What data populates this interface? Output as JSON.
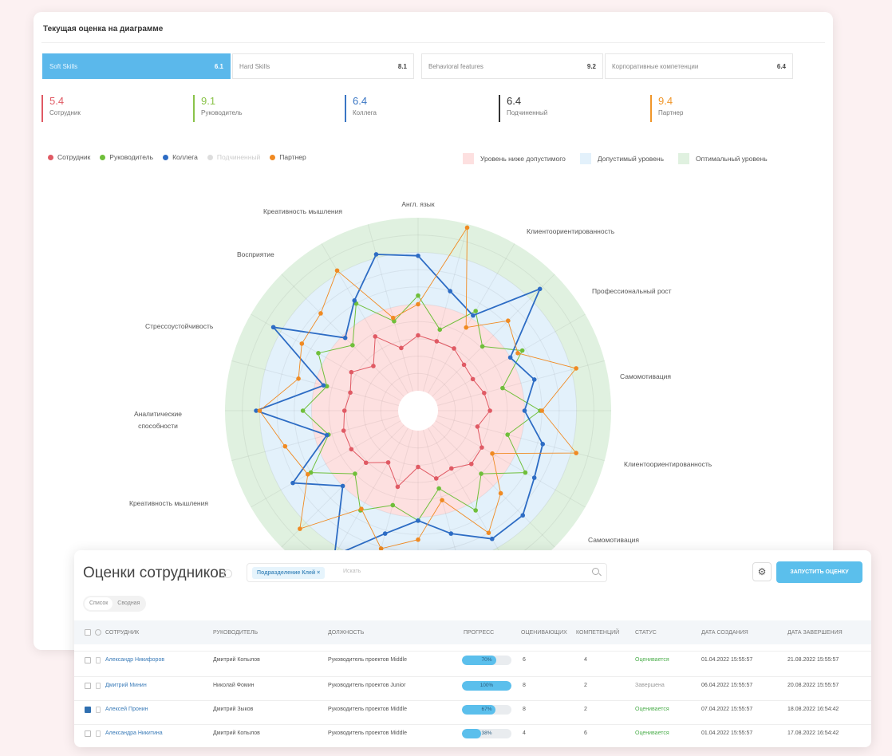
{
  "top": {
    "title": "Текущая оценка на диаграмме",
    "tabs": [
      {
        "label": "Soft Skills",
        "value": "6.1"
      },
      {
        "label": "Hard Skills",
        "value": "8.1"
      },
      {
        "label": "Behavioral features",
        "value": "9.2"
      },
      {
        "label": "Корпоративные компетенции",
        "value": "6.4"
      }
    ],
    "scores": [
      {
        "value": "5.4",
        "label": "Сотрудник",
        "color": "#e05a64"
      },
      {
        "value": "9.1",
        "label": "Руководитель",
        "color": "#8ac34a"
      },
      {
        "value": "6.4",
        "label": "Коллега",
        "color": "#3a76c4"
      },
      {
        "value": "6.4",
        "label": "Подчиненный",
        "color": "#333333"
      },
      {
        "value": "9.4",
        "label": "Партнер",
        "color": "#f0962a"
      }
    ],
    "legend": [
      {
        "label": "Сотрудник",
        "color": "#e05a64"
      },
      {
        "label": "Руководитель",
        "color": "#6fbf3a"
      },
      {
        "label": "Коллега",
        "color": "#2d6cc4"
      },
      {
        "label": "Подчиненный",
        "color": "#dddddd"
      },
      {
        "label": "Партнер",
        "color": "#f08a22"
      }
    ],
    "zones": [
      {
        "label": "Уровень ниже допустимого",
        "color": "#fde0e0"
      },
      {
        "label": "Допустимый уровень",
        "color": "#e3f1fb"
      },
      {
        "label": "Оптимальный уровень",
        "color": "#e0f1e0"
      }
    ]
  },
  "chart_data": {
    "type": "radar",
    "axes": [
      "Англ. язык",
      "Клиентоориентированность",
      "Профессиональный рост",
      "Самомотивация",
      "Клиентоориентированность",
      "Самомотивация",
      "",
      "",
      "Креативность мышления",
      "Аналитические способности",
      "Стрессоустойчивость",
      "Восприятие",
      "Креативность мышления"
    ],
    "series": [
      {
        "name": "Сотрудник",
        "color": "#e05a64",
        "values": [
          3.2,
          3.0,
          3.0,
          2.6,
          2.5,
          2.8,
          3.0,
          2.4,
          3.1,
          3.2,
          2.7,
          2.9,
          2.1,
          3.4,
          2.3,
          3.1,
          3.3,
          3.3,
          3.1,
          2.9,
          3.3,
          2.5,
          3.8,
          2.6
        ]
      },
      {
        "name": "Руководитель",
        "color": "#6fbf3a",
        "values": [
          5.5,
          3.7,
          5.5,
          4.1,
          5.8,
          3.9,
          5.9,
          4.2,
          6.0,
          4.0,
          5.5,
          3.5,
          5.2,
          4.5,
          5.5,
          4.0,
          6.0,
          4.2,
          5.5,
          4.3,
          5.5,
          4.2,
          6.0,
          4.2
        ]
      },
      {
        "name": "Коллега",
        "color": "#2d6cc4",
        "values": [
          7.8,
          6.0,
          5.2,
          8.8,
          5.0,
          5.8,
          5.0,
          6.3,
          6.6,
          7.4,
          7.4,
          6.2,
          5.2,
          6.2,
          8.5,
          5.0,
          7.2,
          4.3,
          8.2,
          4.5,
          8.5,
          4.8,
          6.2,
          8.2
        ]
      },
      {
        "name": "Партнер",
        "color": "#f08a22",
        "values": [
          5.0,
          9.8,
          4.4,
          6.2,
          5.5,
          8.3,
          6.0,
          8.3,
          3.8,
          5.6,
          7.0,
          4.2,
          6.3,
          7.1,
          5.4,
          8.5,
          6.2,
          6.8,
          8.0,
          6.0,
          6.6,
          6.8,
          8.2,
          4.4
        ]
      }
    ],
    "zones": [
      {
        "name": "Уровень ниже допустимого",
        "from": 1,
        "to": 5
      },
      {
        "name": "Допустимый уровень",
        "from": 5,
        "to": 8
      },
      {
        "name": "Оптимальный уровень",
        "from": 8,
        "to": 10
      }
    ],
    "rmin": 0,
    "rmax": 10
  },
  "table": {
    "title": "Оценки сотрудников",
    "filter_chip": "Подразделение Клей ×",
    "search_placeholder": "Искать",
    "gear_glyph": "⚙",
    "start_button": "ЗАПУСТИТЬ ОЦЕНКУ",
    "view_tabs": [
      "Список",
      "Сводная"
    ],
    "columns": [
      "Сотрудник",
      "Руководитель",
      "Должность",
      "Прогресс",
      "Оценивающих",
      "Компетенций",
      "Статус",
      "Дата создания",
      "Дата завершения"
    ],
    "rows": [
      {
        "employee": "Александр Никифоров",
        "manager": "Дмитрий Копылов",
        "position": "Руководитель проектов Middle",
        "progress_label": "70%",
        "progress": 0.7,
        "raters": "6",
        "competencies": "4",
        "status": "Оценивается",
        "status_kind": "ok",
        "created": "01.04.2022 15:55:57",
        "finished": "21.08.2022 15:55:57",
        "checked": false
      },
      {
        "employee": "Дмитрий Минин",
        "manager": "Николай Фомин",
        "position": "Руководитель проектов Junior",
        "progress_label": "100%",
        "progress": 1.0,
        "raters": "8",
        "competencies": "2",
        "status": "Завершена",
        "status_kind": "done",
        "created": "06.04.2022 15:55:57",
        "finished": "20.08.2022 15:55:57",
        "checked": false
      },
      {
        "employee": "Алексей Пронин",
        "manager": "Дмитрий Зыков",
        "position": "Руководитель проектов Middle",
        "progress_label": "67%",
        "progress": 0.67,
        "raters": "8",
        "competencies": "2",
        "status": "Оценивается",
        "status_kind": "ok",
        "created": "07.04.2022 15:55:57",
        "finished": "18.08.2022 16:54:42",
        "checked": true
      },
      {
        "employee": "Александра Никитина",
        "manager": "Дмитрий Копылов",
        "position": "Руководитель проектов Middle",
        "progress_label": "38%",
        "progress": 0.38,
        "raters": "4",
        "competencies": "6",
        "status": "Оценивается",
        "status_kind": "ok",
        "created": "01.04.2022 15:55:57",
        "finished": "17.08.2022 16:54:42",
        "checked": false
      }
    ]
  }
}
